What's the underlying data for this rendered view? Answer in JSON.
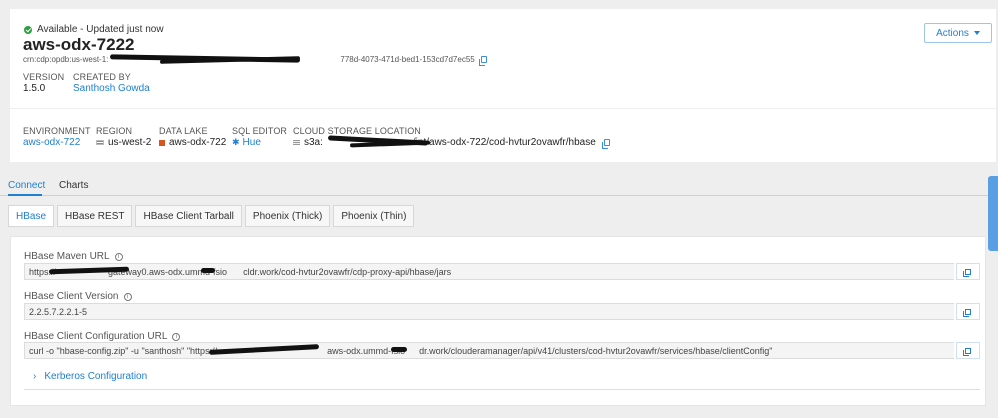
{
  "header": {
    "status": "Available - Updated just now",
    "title": "aws-odx-7222",
    "crn_prefix": "crn:cdp:opdb:us-west-1:",
    "crn_suffix": "778d-4073-471d-bed1-153cd7d7ec55",
    "version_label": "VERSION",
    "version_value": "1.5.0",
    "created_by_label": "CREATED BY",
    "created_by_value": "Santhosh Gowda",
    "actions_label": "Actions"
  },
  "details": {
    "environment_label": "ENVIRONMENT",
    "environment_value": "aws-odx-722",
    "region_label": "REGION",
    "region_value": "us-west-2",
    "datalake_label": "DATA LAKE",
    "datalake_value": "aws-odx-722",
    "sql_editor_label": "SQL EDITOR",
    "sql_editor_value": "Hue",
    "cloud_storage_label": "CLOUD STORAGE LOCATION",
    "cloud_storage_prefix": "s3a:",
    "cloud_storage_suffix": "/int/aws-odx-722/cod-hvtur2ovawfr/hbase"
  },
  "tabs": [
    "Connect",
    "Charts"
  ],
  "subtabs": [
    "HBase",
    "HBase REST",
    "HBase Client Tarball",
    "Phoenix (Thick)",
    "Phoenix (Thin)"
  ],
  "fields": {
    "maven_label": "HBase Maven URL",
    "maven_prefix": "https://",
    "maven_mid": "gateway0.aws-odx.ummd-fsio",
    "maven_suffix": "cldr.work/cod-hvtur2ovawfr/cdp-proxy-api/hbase/jars",
    "version_label": "HBase Client Version",
    "version_value": "2.2.5.7.2.2.1-5",
    "config_label": "HBase Client Configuration URL",
    "config_prefix": "curl -o \"hbase-config.zip\" -u \"santhosh\" \"https://",
    "config_mid": "aws-odx.ummd-fsio",
    "config_suffix": "dr.work/clouderamanager/api/v41/clusters/cod-hvtur2ovawfr/services/hbase/clientConfig\""
  },
  "kerberos_label": "Kerberos Configuration",
  "colors": {
    "accent": "#1f7fd1",
    "success": "#2e9e41"
  }
}
